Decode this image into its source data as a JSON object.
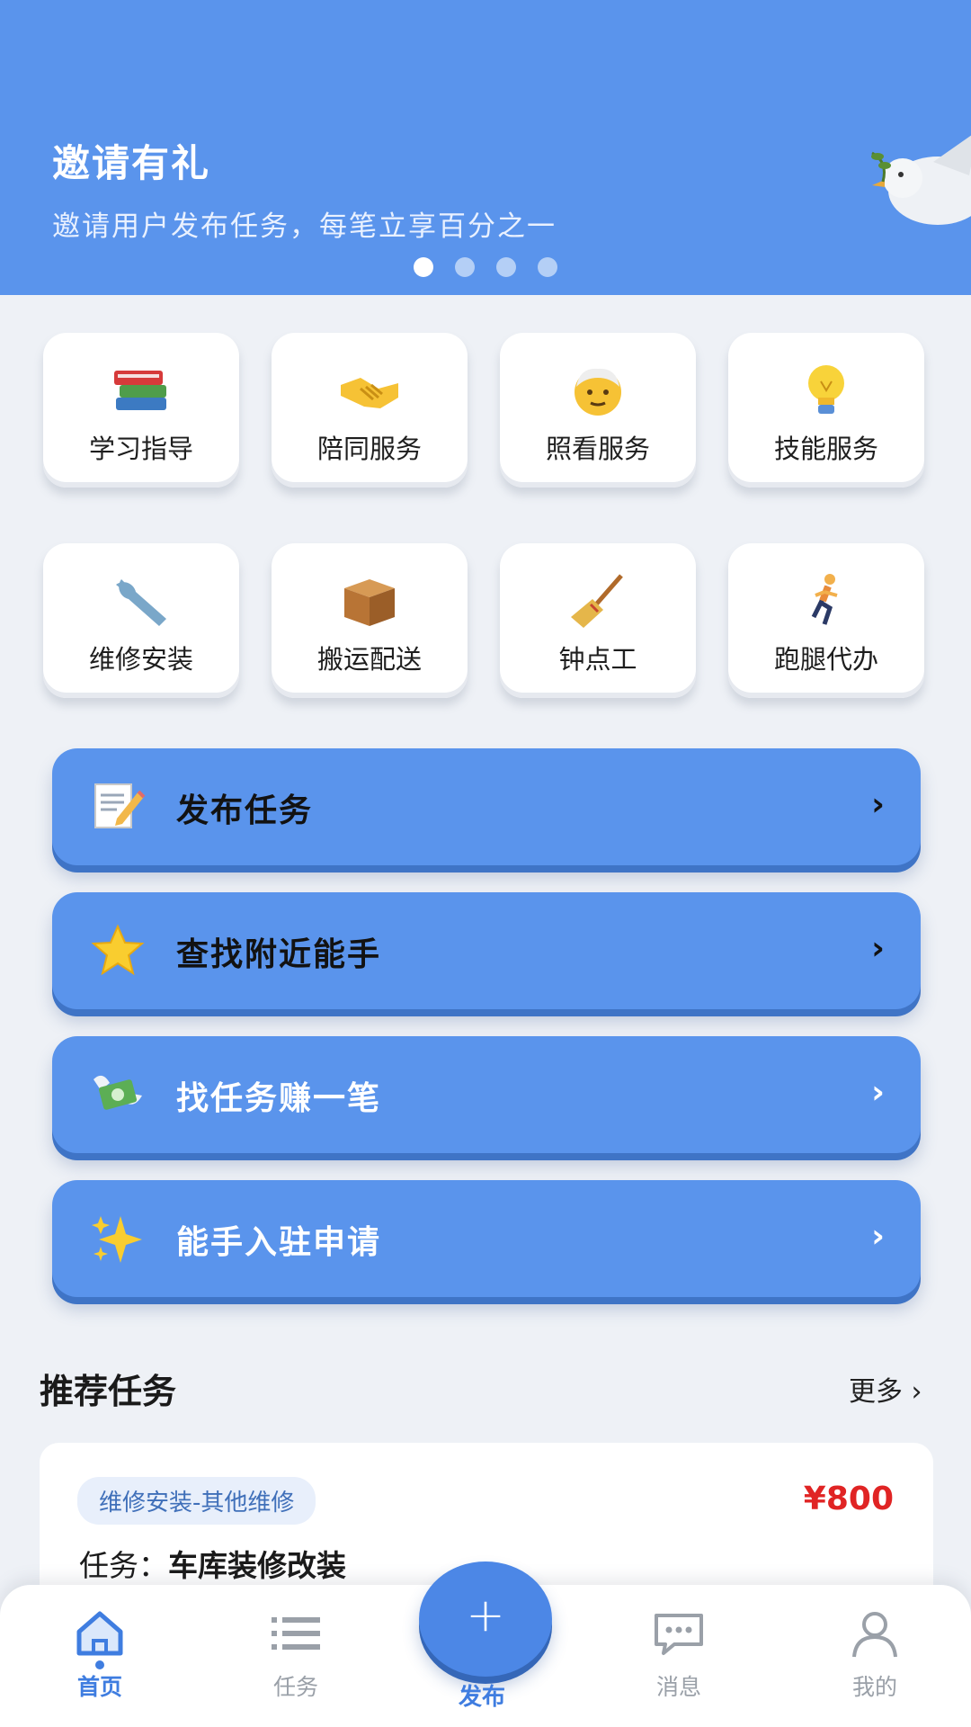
{
  "banner": {
    "title": "邀请有礼",
    "subtitle": "邀请用户发布任务，每笔立享百分之一",
    "slides_total": 4,
    "active_slide": 1
  },
  "categories": [
    {
      "label": "学习指导",
      "icon": "books-icon"
    },
    {
      "label": "陪同服务",
      "icon": "handshake-icon"
    },
    {
      "label": "照看服务",
      "icon": "elder-face-icon"
    },
    {
      "label": "技能服务",
      "icon": "lightbulb-icon"
    },
    {
      "label": "维修安装",
      "icon": "wrench-icon"
    },
    {
      "label": "搬运配送",
      "icon": "package-icon"
    },
    {
      "label": "钟点工",
      "icon": "broom-icon"
    },
    {
      "label": "跑腿代办",
      "icon": "runner-icon"
    }
  ],
  "actions": [
    {
      "label": "发布任务",
      "icon": "memo-icon",
      "chevron": "›"
    },
    {
      "label": "查找附近能手",
      "icon": "star-icon",
      "chevron": "›"
    },
    {
      "label": "找任务赚一笔",
      "icon": "flying-money-icon",
      "chevron": "›"
    },
    {
      "label": "能手入驻申请",
      "icon": "sparkles-icon",
      "chevron": "›"
    }
  ],
  "recommended": {
    "title": "推荐任务",
    "more": "更多 ›",
    "card": {
      "tag": "维修安装-其他维修",
      "price": "¥800",
      "task_prefix": "任务：",
      "task_name": "车库装修改装"
    }
  },
  "nav": {
    "home": "首页",
    "tasks": "任务",
    "publish": "发布",
    "publish_symbol": "+",
    "messages": "消息",
    "me": "我的"
  },
  "colors": {
    "primary": "#5a94ec",
    "accent_text": "#3f7de0",
    "price": "#e02424",
    "background": "#eef1f6"
  }
}
